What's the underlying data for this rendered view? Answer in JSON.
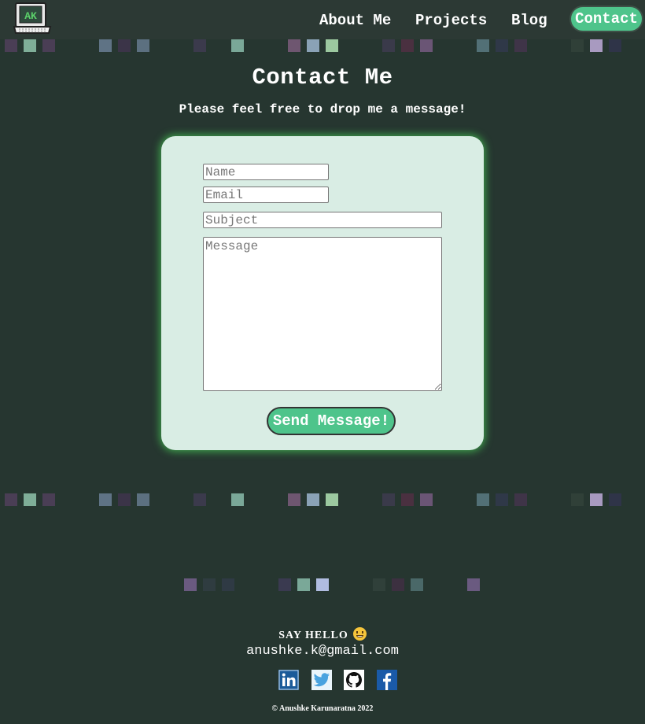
{
  "nav": {
    "logo_text": "AK",
    "about": "About Me",
    "projects": "Projects",
    "blog": "Blog",
    "contact": "Contact"
  },
  "page": {
    "title": "Contact Me",
    "subtitle": "Please feel free to drop me a message!"
  },
  "form": {
    "name_placeholder": "Name",
    "email_placeholder": "Email",
    "subject_placeholder": "Subject",
    "message_placeholder": "Message",
    "name_value": "",
    "email_value": "",
    "subject_value": "",
    "message_value": "",
    "submit_label": "Send Message!"
  },
  "footer": {
    "say_hello": "SAY HELLO",
    "email": "anushke.k@gmail.com",
    "social_icons": [
      "linkedin-icon",
      "twitter-icon",
      "github-icon",
      "facebook-icon"
    ],
    "copyright": "© Anushke Karunaratna 2022"
  },
  "colors": {
    "background": "#263630",
    "navbar": "#2c3934",
    "accent": "#4ec48b",
    "card": "#d9ede4",
    "card_glow": "#3ea24b"
  }
}
